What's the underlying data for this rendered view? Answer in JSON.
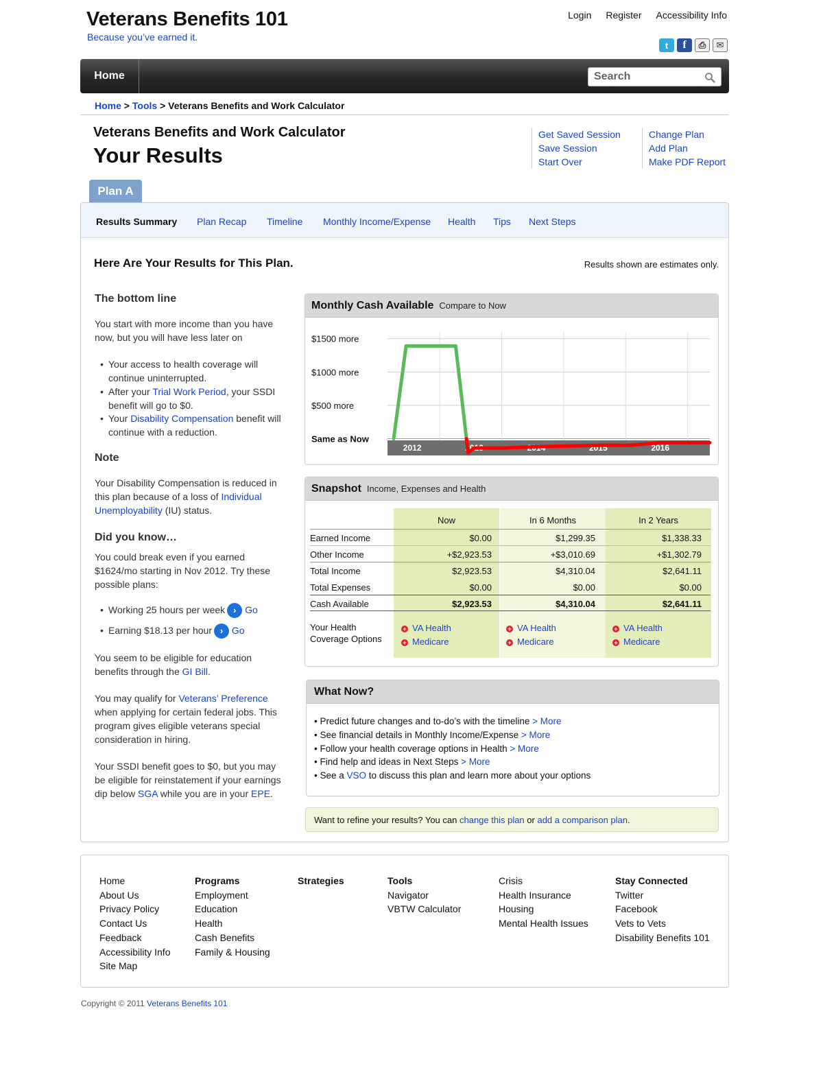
{
  "header": {
    "site_title": "Veterans Benefits 101",
    "tagline": "Because you’ve earned it.",
    "top_links": [
      "Login",
      "Register",
      "Accessibility Info"
    ],
    "social": [
      {
        "icon": "twitter-icon",
        "glyph": "t"
      },
      {
        "icon": "facebook-icon",
        "glyph": "f"
      },
      {
        "icon": "print-icon",
        "glyph": "⎙"
      },
      {
        "icon": "email-icon",
        "glyph": "✉"
      }
    ]
  },
  "nav": {
    "home": "Home",
    "search_placeholder": "Search"
  },
  "breadcrumb": {
    "home": "Home",
    "tools": "Tools",
    "sep": ">",
    "current": "Veterans Benefits and Work Calculator"
  },
  "page": {
    "calc_title": "Veterans Benefits and Work Calculator",
    "results_title": "Your Results",
    "actions_left": [
      "Get Saved Session",
      "Save Session",
      "Start Over"
    ],
    "actions_right": [
      "Change Plan",
      "Add Plan",
      "Make PDF Report"
    ],
    "plan_tab": "Plan A"
  },
  "subtabs": [
    "Results Summary",
    "Plan Recap",
    "Timeline",
    "Monthly Income/Expense",
    "Health",
    "Tips",
    "Next Steps"
  ],
  "results": {
    "heading": "Here Are Your Results for This Plan.",
    "estimates": "Results shown are estimates only."
  },
  "left": {
    "bottom_line_head": "The bottom line",
    "bottom_line_text": "You start with more income than you have now, but you will have less later on",
    "bullets": [
      {
        "pre": "Your access to health coverage will continue uninterrupted.",
        "link": "",
        "post": ""
      },
      {
        "pre": "After your ",
        "link": "Trial Work Period",
        "post": ", your SSDI benefit will go to $0."
      },
      {
        "pre": "Your ",
        "link": "Disability Compensation",
        "post": " benefit will continue with a reduction."
      }
    ],
    "note_head": "Note",
    "note_pre": "Your Disability Compensation is reduced in this plan because of a loss of ",
    "note_link": "Individual Unemployability",
    "note_post": " (IU) status.",
    "dyk_head": "Did you know…",
    "dyk_text": "You could break even if you earned $1624/mo starting in Nov 2012. Try these possible plans:",
    "plans": [
      {
        "text": "Working 25 hours per week",
        "go": "Go"
      },
      {
        "text": "Earning $18.13 per hour",
        "go": "Go"
      }
    ],
    "edu_pre": "You seem to be eligible for education benefits through the ",
    "edu_link": "GI Bill",
    "edu_post": ".",
    "vp_pre": "You may qualify for ",
    "vp_link": "Veterans’ Preference",
    "vp_post": " when applying for certain federal jobs. This program gives eligible veterans special consideration in hiring.",
    "ssdi_pre": "Your SSDI benefit goes to $0, but you may be eligible for reinstatement if your earnings dip below ",
    "ssdi_link1": "SGA",
    "ssdi_mid": " while you are in your ",
    "ssdi_link2": "EPE",
    "ssdi_post": "."
  },
  "chart_panel": {
    "title": "Monthly Cash Available",
    "subtitle": "Compare to Now"
  },
  "chart_data": {
    "type": "line",
    "y_tick_labels": [
      "$1500 more",
      "$1000 more",
      "$500 more",
      "Same as Now"
    ],
    "y_tick_values": [
      1500,
      1000,
      500,
      0
    ],
    "x_tick_labels": [
      "2012",
      "2013",
      "2014",
      "2015",
      "2016"
    ],
    "x_tick_values": [
      2012,
      2013,
      2014,
      2015,
      2016
    ],
    "ylim": [
      -200,
      1600
    ],
    "xlim": [
      2011.6,
      2016.8
    ],
    "colors": {
      "above": "#5cb85c",
      "below": "#ff0000"
    },
    "series": [
      {
        "points": [
          [
            2011.7,
            0
          ],
          [
            2011.9,
            1390
          ],
          [
            2012.7,
            1390
          ],
          [
            2012.9,
            -210
          ],
          [
            2013.0,
            -140
          ],
          [
            2013.5,
            -140
          ],
          [
            2014.0,
            -120
          ],
          [
            2015.0,
            -100
          ],
          [
            2015.5,
            -100
          ],
          [
            2016.0,
            -60
          ],
          [
            2016.8,
            -60
          ]
        ]
      }
    ]
  },
  "snapshot": {
    "title": "Snapshot",
    "subtitle": "Income, Expenses and Health",
    "columns": [
      "Now",
      "In 6 Months",
      "In 2 Years"
    ],
    "rows": [
      {
        "label": "Earned Income",
        "values": [
          "$0.00",
          "$1,299.35",
          "$1,338.33"
        ]
      },
      {
        "label": "Other Income",
        "values": [
          "+$2,923.53",
          "+$3,010.69",
          "+$1,302.79"
        ]
      },
      {
        "label": "Total Income",
        "values": [
          "$2,923.53",
          "$4,310.04",
          "$2,641.11"
        ]
      },
      {
        "label": "Total Expenses",
        "values": [
          "$0.00",
          "$0.00",
          "$0.00"
        ]
      },
      {
        "label": "Cash Available",
        "values": [
          "$2,923.53",
          "$4,310.04",
          "$2,641.11"
        ]
      }
    ],
    "health_label_1": "Your Health",
    "health_label_2": "Coverage Options",
    "health_options": [
      "VA Health",
      "Medicare"
    ],
    "colors": {
      "col_dark": "#e3edb9",
      "col_light": "#f2f6dd"
    }
  },
  "what_now": {
    "title": "What Now?",
    "items": [
      {
        "pre": "Predict future changes and to-do’s with the timeline ",
        "link": "> More",
        "post": ""
      },
      {
        "pre": "See financial details in Monthly Income/Expense ",
        "link": "> More",
        "post": ""
      },
      {
        "pre": "Follow your health coverage options in Health ",
        "link": "> More",
        "post": ""
      },
      {
        "pre": "Find help and ideas in Next Steps ",
        "link": "> More",
        "post": ""
      },
      {
        "pre": "See a ",
        "link": "VSO",
        "post": " to discuss this plan and learn more about your options"
      }
    ]
  },
  "refine": {
    "pre": "Want to refine your results? You can ",
    "link1": "change this plan",
    "mid": " or ",
    "link2": "add a comparison plan",
    "post": "."
  },
  "footer": {
    "col1": [
      "Home",
      "About Us",
      "Privacy Policy",
      "Contact Us",
      "Feedback",
      "Accessibility Info",
      "Site Map"
    ],
    "col2_head": "Programs",
    "col2": [
      "Employment",
      "Education",
      "Health",
      "Cash Benefits",
      "Family & Housing"
    ],
    "col3_head": "Strategies",
    "col4_head": "Tools",
    "col4": [
      "Navigator",
      "VBTW Calculator"
    ],
    "col5": [
      "Crisis",
      "Health Insurance",
      "Housing",
      "Mental Health Issues"
    ],
    "col6_head": "Stay Connected",
    "col6": [
      "Twitter",
      "Facebook",
      "Vets to Vets",
      "Disability Benefits 101"
    ]
  },
  "copyright": {
    "text": "Copyright © 2011 ",
    "link": "Veterans Benefits 101"
  }
}
